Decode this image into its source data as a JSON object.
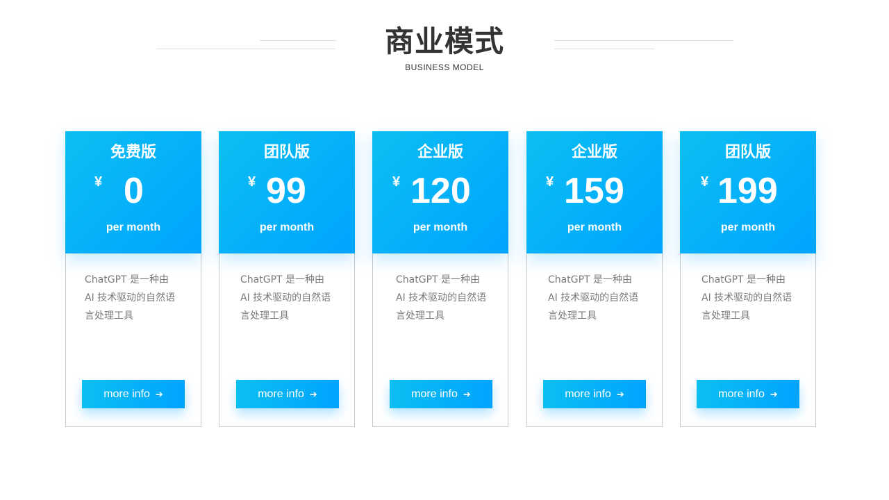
{
  "header": {
    "title": "商业模式",
    "subtitle": "BUSINESS MODEL"
  },
  "cards": [
    {
      "plan": "免费版",
      "currency": "¥",
      "price": "0",
      "period": "per month",
      "desc": [
        "ChatGPT 是一种由",
        "AI 技术驱动的自然语",
        "言处理工具"
      ],
      "button": "more info"
    },
    {
      "plan": "团队版",
      "currency": "¥",
      "price": "99",
      "period": "per month",
      "desc": [
        "ChatGPT 是一种由",
        "AI 技术驱动的自然语",
        "言处理工具"
      ],
      "button": "more info"
    },
    {
      "plan": "企业版",
      "currency": "¥",
      "price": "120",
      "period": "per month",
      "desc": [
        "ChatGPT 是一种由",
        "AI 技术驱动的自然语",
        "言处理工具"
      ],
      "button": "more info"
    },
    {
      "plan": "企业版",
      "currency": "¥",
      "price": "159",
      "period": "per month",
      "desc": [
        "ChatGPT 是一种由",
        "AI 技术驱动的自然语",
        "言处理工具"
      ],
      "button": "more info"
    },
    {
      "plan": "团队版",
      "currency": "¥",
      "price": "199",
      "period": "per month",
      "desc": [
        "ChatGPT 是一种由",
        "AI 技术驱动的自然语",
        "言处理工具"
      ],
      "button": "more info"
    }
  ],
  "colors": {
    "accent_start": "#0bbff2",
    "accent_end": "#00a4ff",
    "title": "#333333",
    "body_text": "#7a7a7a",
    "card_border": "#c8c8c8"
  },
  "icons": {
    "button_arrow": "arrow-right-icon"
  }
}
